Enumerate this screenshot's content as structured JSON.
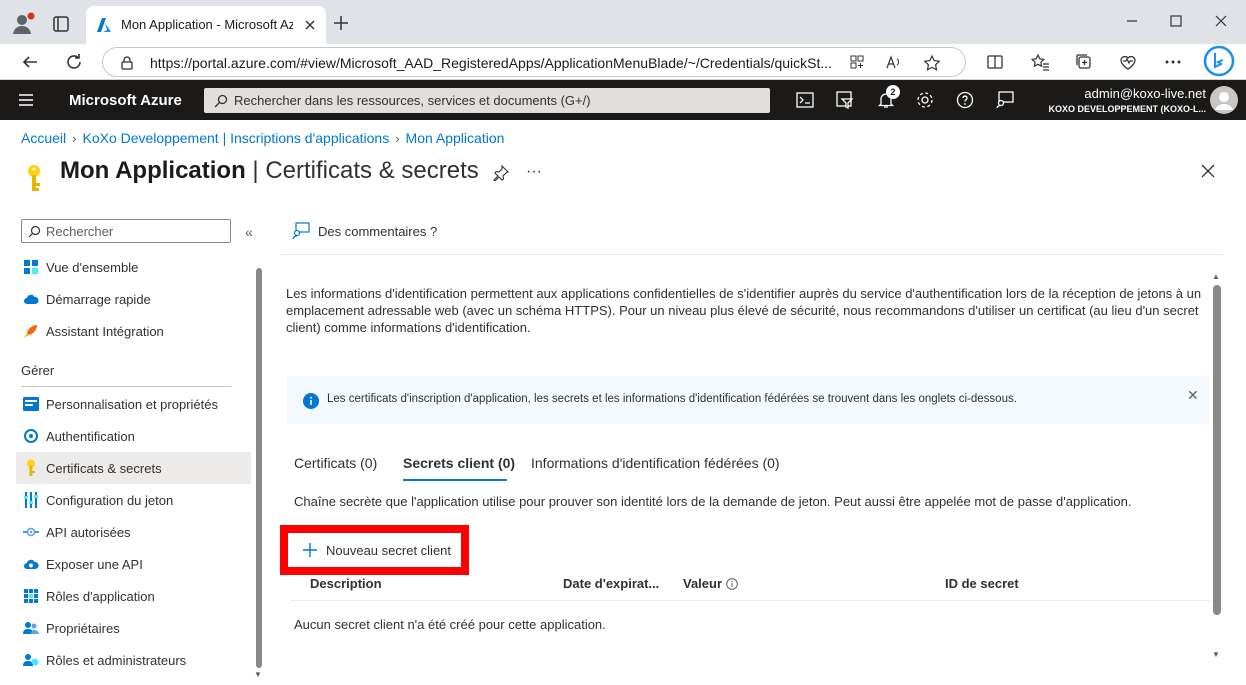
{
  "browser": {
    "tab_title": "Mon Application - Microsoft Azu",
    "url": "https://portal.azure.com/#view/Microsoft_AAD_RegisteredApps/ApplicationMenuBlade/~/Credentials/quickSt..."
  },
  "azure_bar": {
    "brand": "Microsoft Azure",
    "search_placeholder": "Rechercher dans les ressources, services et documents (G+/)",
    "notification_count": "2",
    "account_email": "admin@koxo-live.net",
    "account_tenant": "KOXO DEVELOPPEMENT (KOXO-L..."
  },
  "breadcrumb": {
    "items": [
      "Accueil",
      "KoXo Developpement | Inscriptions d'applications",
      "Mon Application"
    ]
  },
  "page": {
    "title_main": "Mon Application",
    "title_sep": " | ",
    "title_sub": "Certificats & secrets",
    "more": "···"
  },
  "sidebar": {
    "search_placeholder": "Rechercher",
    "collapse": "«",
    "section_manage": "Gérer",
    "items": [
      {
        "label": "Vue d'ensemble",
        "icon": "grid-icon"
      },
      {
        "label": "Démarrage rapide",
        "icon": "cloud-icon"
      },
      {
        "label": "Assistant Intégration",
        "icon": "rocket-icon"
      },
      {
        "label": "Personnalisation et propriétés",
        "icon": "branding-icon"
      },
      {
        "label": "Authentification",
        "icon": "refresh-icon"
      },
      {
        "label": "Certificats & secrets",
        "icon": "key-icon"
      },
      {
        "label": "Configuration du jeton",
        "icon": "token-icon"
      },
      {
        "label": "API autorisées",
        "icon": "api-icon"
      },
      {
        "label": "Exposer une API",
        "icon": "cloud-api-icon"
      },
      {
        "label": "Rôles d'application",
        "icon": "roles-icon"
      },
      {
        "label": "Propriétaires",
        "icon": "people-icon"
      },
      {
        "label": "Rôles et administrateurs",
        "icon": "admin-people-icon"
      }
    ]
  },
  "main": {
    "feedback_label": "Des commentaires ?",
    "intro": "Les informations d'identification permettent aux applications confidentielles de s'identifier auprès du service d'authentification lors de la réception de jetons à un emplacement adressable web (avec un schéma HTTPS). Pour un niveau plus élevé de sécurité, nous recommandons d'utiliser un certificat (au lieu d'un secret client) comme informations d'identification.",
    "info_banner": "Les certificats d'inscription d'application, les secrets et les informations d'identification fédérées se trouvent dans les onglets ci-dessous.",
    "info_close": "✕",
    "tabs": [
      "Certificats (0)",
      "Secrets client (0)",
      "Informations d'identification fédérées (0)"
    ],
    "selected_tab": "Secrets client (0)",
    "secret_description": "Chaîne secrète que l'application utilise pour prouver son identité lors de la demande de jeton. Peut aussi être appelée mot de passe d'application.",
    "new_secret_button": "Nouveau secret client",
    "columns": [
      "Description",
      "Date d'expirat...",
      "Valeur",
      "ID de secret"
    ],
    "empty_message": "Aucun secret client n'a été créé pour cette application."
  },
  "colors": {
    "azure_bar": "#1b1a19",
    "link": "#0078d4",
    "highlight": "#ff0000",
    "info_bg": "#f3f9fd"
  }
}
